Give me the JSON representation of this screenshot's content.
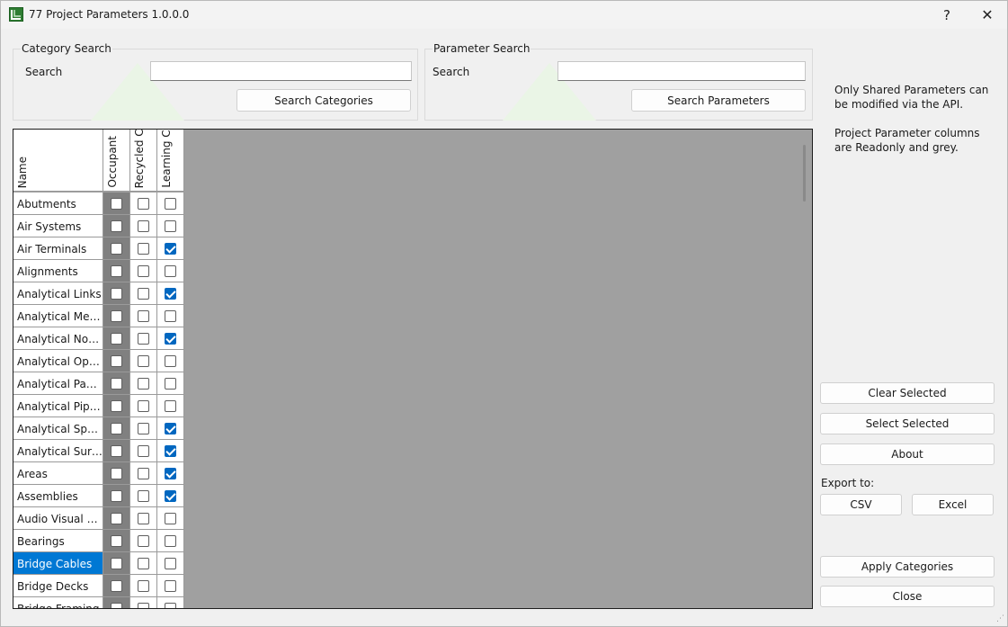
{
  "window": {
    "title": "77 Project Parameters 1.0.0.0",
    "help_label": "?",
    "close_glyph": "✕"
  },
  "category_search": {
    "group_title": "Category Search",
    "search_label": "Search",
    "input_value": "",
    "button_label": "Search Categories"
  },
  "parameter_search": {
    "group_title": "Parameter Search",
    "search_label": "Search",
    "input_value": "",
    "button_label": "Search Parameters"
  },
  "grid": {
    "name_header": "Name",
    "columns": [
      "Occupant",
      "Recycled Co",
      "Learning Co"
    ],
    "rows": [
      {
        "name": "Abutments",
        "checks": [
          false,
          false,
          false
        ],
        "selected": false
      },
      {
        "name": "Air Systems",
        "checks": [
          false,
          false,
          false
        ],
        "selected": false
      },
      {
        "name": "Air Terminals",
        "checks": [
          false,
          false,
          true
        ],
        "selected": false
      },
      {
        "name": "Alignments",
        "checks": [
          false,
          false,
          false
        ],
        "selected": false
      },
      {
        "name": "Analytical Links",
        "checks": [
          false,
          false,
          true
        ],
        "selected": false
      },
      {
        "name": "Analytical Mem…",
        "checks": [
          false,
          false,
          false
        ],
        "selected": false
      },
      {
        "name": "Analytical Nodes",
        "checks": [
          false,
          false,
          true
        ],
        "selected": false
      },
      {
        "name": "Analytical Ope…",
        "checks": [
          false,
          false,
          false
        ],
        "selected": false
      },
      {
        "name": "Analytical Panels",
        "checks": [
          false,
          false,
          false
        ],
        "selected": false
      },
      {
        "name": "Analytical Pipe …",
        "checks": [
          false,
          false,
          false
        ],
        "selected": false
      },
      {
        "name": "Analytical Spaces",
        "checks": [
          false,
          false,
          true
        ],
        "selected": false
      },
      {
        "name": "Analytical Surfa…",
        "checks": [
          false,
          false,
          true
        ],
        "selected": false
      },
      {
        "name": "Areas",
        "checks": [
          false,
          false,
          true
        ],
        "selected": false
      },
      {
        "name": "Assemblies",
        "checks": [
          false,
          false,
          true
        ],
        "selected": false
      },
      {
        "name": "Audio Visual De…",
        "checks": [
          false,
          false,
          false
        ],
        "selected": false
      },
      {
        "name": "Bearings",
        "checks": [
          false,
          false,
          false
        ],
        "selected": false
      },
      {
        "name": "Bridge Cables",
        "checks": [
          false,
          false,
          false
        ],
        "selected": true
      },
      {
        "name": "Bridge Decks",
        "checks": [
          false,
          false,
          false
        ],
        "selected": false
      },
      {
        "name": "Bridge Framing",
        "checks": [
          false,
          false,
          false
        ],
        "selected": false
      }
    ]
  },
  "info": {
    "line1": "Only Shared Parameters can be modified via the API.",
    "line2": "Project Parameter columns are Readonly and grey."
  },
  "actions": {
    "clear_selected": "Clear Selected",
    "select_selected": "Select Selected",
    "about": "About",
    "export_label": "Export to:",
    "csv": "CSV",
    "excel": "Excel",
    "apply_categories": "Apply Categories",
    "close": "Close"
  }
}
